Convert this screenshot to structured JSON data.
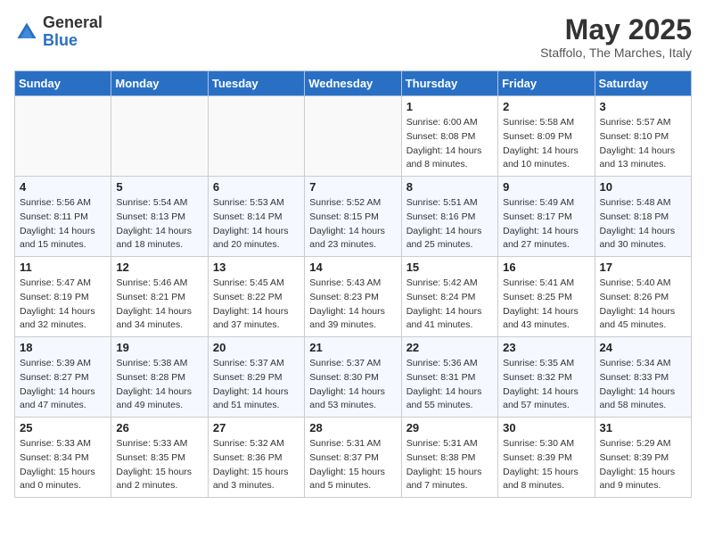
{
  "logo": {
    "general": "General",
    "blue": "Blue"
  },
  "title": "May 2025",
  "subtitle": "Staffolo, The Marches, Italy",
  "days_of_week": [
    "Sunday",
    "Monday",
    "Tuesday",
    "Wednesday",
    "Thursday",
    "Friday",
    "Saturday"
  ],
  "weeks": [
    [
      {
        "day": "",
        "info": ""
      },
      {
        "day": "",
        "info": ""
      },
      {
        "day": "",
        "info": ""
      },
      {
        "day": "",
        "info": ""
      },
      {
        "day": "1",
        "sunrise": "Sunrise: 6:00 AM",
        "sunset": "Sunset: 8:08 PM",
        "daylight": "Daylight: 14 hours and 8 minutes."
      },
      {
        "day": "2",
        "sunrise": "Sunrise: 5:58 AM",
        "sunset": "Sunset: 8:09 PM",
        "daylight": "Daylight: 14 hours and 10 minutes."
      },
      {
        "day": "3",
        "sunrise": "Sunrise: 5:57 AM",
        "sunset": "Sunset: 8:10 PM",
        "daylight": "Daylight: 14 hours and 13 minutes."
      }
    ],
    [
      {
        "day": "4",
        "sunrise": "Sunrise: 5:56 AM",
        "sunset": "Sunset: 8:11 PM",
        "daylight": "Daylight: 14 hours and 15 minutes."
      },
      {
        "day": "5",
        "sunrise": "Sunrise: 5:54 AM",
        "sunset": "Sunset: 8:13 PM",
        "daylight": "Daylight: 14 hours and 18 minutes."
      },
      {
        "day": "6",
        "sunrise": "Sunrise: 5:53 AM",
        "sunset": "Sunset: 8:14 PM",
        "daylight": "Daylight: 14 hours and 20 minutes."
      },
      {
        "day": "7",
        "sunrise": "Sunrise: 5:52 AM",
        "sunset": "Sunset: 8:15 PM",
        "daylight": "Daylight: 14 hours and 23 minutes."
      },
      {
        "day": "8",
        "sunrise": "Sunrise: 5:51 AM",
        "sunset": "Sunset: 8:16 PM",
        "daylight": "Daylight: 14 hours and 25 minutes."
      },
      {
        "day": "9",
        "sunrise": "Sunrise: 5:49 AM",
        "sunset": "Sunset: 8:17 PM",
        "daylight": "Daylight: 14 hours and 27 minutes."
      },
      {
        "day": "10",
        "sunrise": "Sunrise: 5:48 AM",
        "sunset": "Sunset: 8:18 PM",
        "daylight": "Daylight: 14 hours and 30 minutes."
      }
    ],
    [
      {
        "day": "11",
        "sunrise": "Sunrise: 5:47 AM",
        "sunset": "Sunset: 8:19 PM",
        "daylight": "Daylight: 14 hours and 32 minutes."
      },
      {
        "day": "12",
        "sunrise": "Sunrise: 5:46 AM",
        "sunset": "Sunset: 8:21 PM",
        "daylight": "Daylight: 14 hours and 34 minutes."
      },
      {
        "day": "13",
        "sunrise": "Sunrise: 5:45 AM",
        "sunset": "Sunset: 8:22 PM",
        "daylight": "Daylight: 14 hours and 37 minutes."
      },
      {
        "day": "14",
        "sunrise": "Sunrise: 5:43 AM",
        "sunset": "Sunset: 8:23 PM",
        "daylight": "Daylight: 14 hours and 39 minutes."
      },
      {
        "day": "15",
        "sunrise": "Sunrise: 5:42 AM",
        "sunset": "Sunset: 8:24 PM",
        "daylight": "Daylight: 14 hours and 41 minutes."
      },
      {
        "day": "16",
        "sunrise": "Sunrise: 5:41 AM",
        "sunset": "Sunset: 8:25 PM",
        "daylight": "Daylight: 14 hours and 43 minutes."
      },
      {
        "day": "17",
        "sunrise": "Sunrise: 5:40 AM",
        "sunset": "Sunset: 8:26 PM",
        "daylight": "Daylight: 14 hours and 45 minutes."
      }
    ],
    [
      {
        "day": "18",
        "sunrise": "Sunrise: 5:39 AM",
        "sunset": "Sunset: 8:27 PM",
        "daylight": "Daylight: 14 hours and 47 minutes."
      },
      {
        "day": "19",
        "sunrise": "Sunrise: 5:38 AM",
        "sunset": "Sunset: 8:28 PM",
        "daylight": "Daylight: 14 hours and 49 minutes."
      },
      {
        "day": "20",
        "sunrise": "Sunrise: 5:37 AM",
        "sunset": "Sunset: 8:29 PM",
        "daylight": "Daylight: 14 hours and 51 minutes."
      },
      {
        "day": "21",
        "sunrise": "Sunrise: 5:37 AM",
        "sunset": "Sunset: 8:30 PM",
        "daylight": "Daylight: 14 hours and 53 minutes."
      },
      {
        "day": "22",
        "sunrise": "Sunrise: 5:36 AM",
        "sunset": "Sunset: 8:31 PM",
        "daylight": "Daylight: 14 hours and 55 minutes."
      },
      {
        "day": "23",
        "sunrise": "Sunrise: 5:35 AM",
        "sunset": "Sunset: 8:32 PM",
        "daylight": "Daylight: 14 hours and 57 minutes."
      },
      {
        "day": "24",
        "sunrise": "Sunrise: 5:34 AM",
        "sunset": "Sunset: 8:33 PM",
        "daylight": "Daylight: 14 hours and 58 minutes."
      }
    ],
    [
      {
        "day": "25",
        "sunrise": "Sunrise: 5:33 AM",
        "sunset": "Sunset: 8:34 PM",
        "daylight": "Daylight: 15 hours and 0 minutes."
      },
      {
        "day": "26",
        "sunrise": "Sunrise: 5:33 AM",
        "sunset": "Sunset: 8:35 PM",
        "daylight": "Daylight: 15 hours and 2 minutes."
      },
      {
        "day": "27",
        "sunrise": "Sunrise: 5:32 AM",
        "sunset": "Sunset: 8:36 PM",
        "daylight": "Daylight: 15 hours and 3 minutes."
      },
      {
        "day": "28",
        "sunrise": "Sunrise: 5:31 AM",
        "sunset": "Sunset: 8:37 PM",
        "daylight": "Daylight: 15 hours and 5 minutes."
      },
      {
        "day": "29",
        "sunrise": "Sunrise: 5:31 AM",
        "sunset": "Sunset: 8:38 PM",
        "daylight": "Daylight: 15 hours and 7 minutes."
      },
      {
        "day": "30",
        "sunrise": "Sunrise: 5:30 AM",
        "sunset": "Sunset: 8:39 PM",
        "daylight": "Daylight: 15 hours and 8 minutes."
      },
      {
        "day": "31",
        "sunrise": "Sunrise: 5:29 AM",
        "sunset": "Sunset: 8:39 PM",
        "daylight": "Daylight: 15 hours and 9 minutes."
      }
    ]
  ]
}
